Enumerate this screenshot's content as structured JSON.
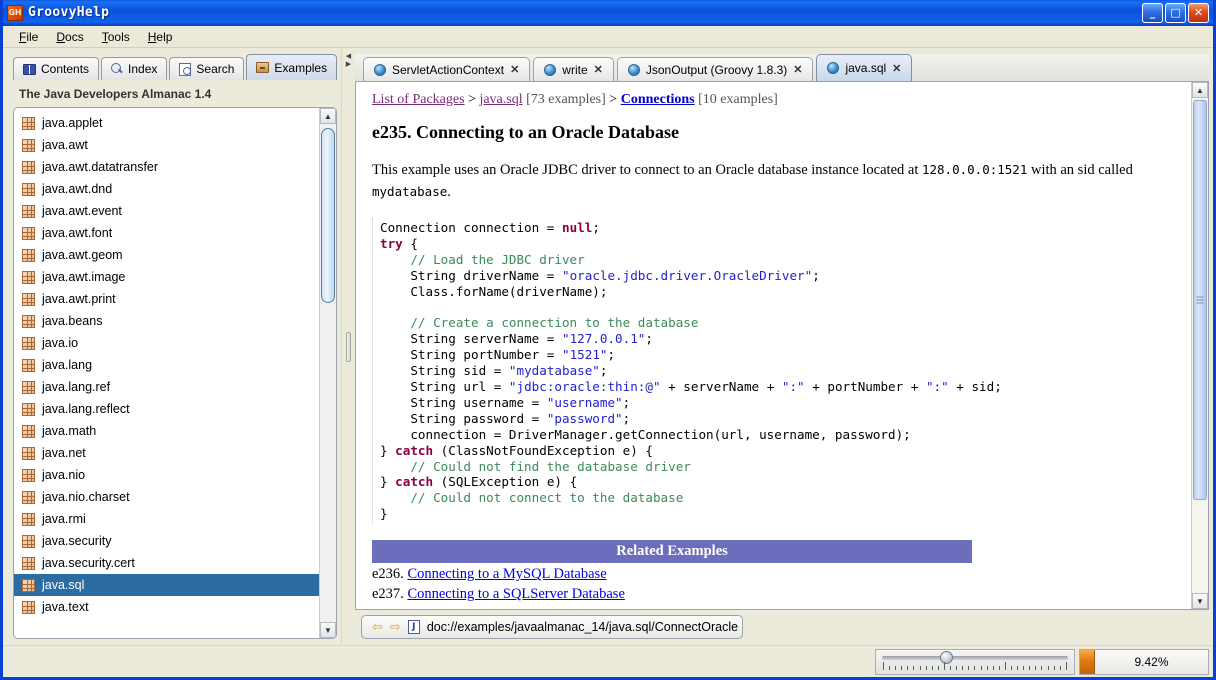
{
  "window": {
    "title": "GroovyHelp",
    "icon": "app-icon",
    "buttons": {
      "minimize": "_",
      "maximize": "□",
      "close": "✕"
    }
  },
  "menubar": {
    "items": [
      {
        "label": "File",
        "mnemonic": "F"
      },
      {
        "label": "Docs",
        "mnemonic": "D"
      },
      {
        "label": "Tools",
        "mnemonic": "T"
      },
      {
        "label": "Help",
        "mnemonic": "H"
      }
    ]
  },
  "sidebar": {
    "tabs": [
      {
        "label": "Contents",
        "icon": "book-icon",
        "active": false
      },
      {
        "label": "Index",
        "icon": "magnifier-icon",
        "active": false
      },
      {
        "label": "Search",
        "icon": "document-search-icon",
        "active": false
      },
      {
        "label": "Examples",
        "icon": "drawer-icon",
        "active": true
      }
    ],
    "heading": "The Java Developers Almanac 1.4",
    "tree_items": [
      {
        "label": "java.applet",
        "selected": false
      },
      {
        "label": "java.awt",
        "selected": false
      },
      {
        "label": "java.awt.datatransfer",
        "selected": false
      },
      {
        "label": "java.awt.dnd",
        "selected": false
      },
      {
        "label": "java.awt.event",
        "selected": false
      },
      {
        "label": "java.awt.font",
        "selected": false
      },
      {
        "label": "java.awt.geom",
        "selected": false
      },
      {
        "label": "java.awt.image",
        "selected": false
      },
      {
        "label": "java.awt.print",
        "selected": false
      },
      {
        "label": "java.beans",
        "selected": false
      },
      {
        "label": "java.io",
        "selected": false
      },
      {
        "label": "java.lang",
        "selected": false
      },
      {
        "label": "java.lang.ref",
        "selected": false
      },
      {
        "label": "java.lang.reflect",
        "selected": false
      },
      {
        "label": "java.math",
        "selected": false
      },
      {
        "label": "java.net",
        "selected": false
      },
      {
        "label": "java.nio",
        "selected": false
      },
      {
        "label": "java.nio.charset",
        "selected": false
      },
      {
        "label": "java.rmi",
        "selected": false
      },
      {
        "label": "java.security",
        "selected": false
      },
      {
        "label": "java.security.cert",
        "selected": false
      },
      {
        "label": "java.sql",
        "selected": true
      },
      {
        "label": "java.text",
        "selected": false
      }
    ]
  },
  "editor": {
    "tabs": [
      {
        "label": "ServletActionContext",
        "icon": "globe-icon",
        "close": "✕",
        "active": false
      },
      {
        "label": "write",
        "icon": "globe-icon",
        "close": "✕",
        "active": false
      },
      {
        "label": "JsonOutput (Groovy 1.8.3)",
        "icon": "globe-icon",
        "close": "✕",
        "active": false
      },
      {
        "label": "java.sql",
        "icon": "globe-icon",
        "close": "✕",
        "active": true
      }
    ]
  },
  "document": {
    "breadcrumb": {
      "packages_link": "List of Packages",
      "sep1": " > ",
      "package_link": "java.sql",
      "package_count": "[73 examples]",
      "sep2": " > ",
      "section_link": "Connections",
      "section_count": "[10 examples]"
    },
    "title": "e235. Connecting to an Oracle Database",
    "paragraph": {
      "part1": "This example uses an Oracle JDBC driver to connect to an Oracle database instance located at ",
      "host": "128.0.0.0:1521",
      "part2": " with an sid called ",
      "sid": "mydatabase",
      "part3": "."
    },
    "code_lines": [
      [
        {
          "t": "Connection connection = ",
          "c": ""
        },
        {
          "t": "null",
          "c": "kw"
        },
        {
          "t": ";",
          "c": ""
        }
      ],
      [
        {
          "t": "try",
          "c": "kw"
        },
        {
          "t": " {",
          "c": ""
        }
      ],
      [
        {
          "t": "    // Load the JDBC driver",
          "c": "cm"
        }
      ],
      [
        {
          "t": "    String driverName = ",
          "c": ""
        },
        {
          "t": "\"oracle.jdbc.driver.OracleDriver\"",
          "c": "st"
        },
        {
          "t": ";",
          "c": ""
        }
      ],
      [
        {
          "t": "    Class.forName(driverName);",
          "c": ""
        }
      ],
      [
        {
          "t": "",
          "c": ""
        }
      ],
      [
        {
          "t": "    // Create a connection to the database",
          "c": "cm"
        }
      ],
      [
        {
          "t": "    String serverName = ",
          "c": ""
        },
        {
          "t": "\"127.0.0.1\"",
          "c": "st"
        },
        {
          "t": ";",
          "c": ""
        }
      ],
      [
        {
          "t": "    String portNumber = ",
          "c": ""
        },
        {
          "t": "\"1521\"",
          "c": "st"
        },
        {
          "t": ";",
          "c": ""
        }
      ],
      [
        {
          "t": "    String sid = ",
          "c": ""
        },
        {
          "t": "\"mydatabase\"",
          "c": "st"
        },
        {
          "t": ";",
          "c": ""
        }
      ],
      [
        {
          "t": "    String url = ",
          "c": ""
        },
        {
          "t": "\"jdbc:oracle:thin:@\"",
          "c": "st"
        },
        {
          "t": " + serverName + ",
          "c": ""
        },
        {
          "t": "\":\"",
          "c": "st"
        },
        {
          "t": " + portNumber + ",
          "c": ""
        },
        {
          "t": "\":\"",
          "c": "st"
        },
        {
          "t": " + sid;",
          "c": ""
        }
      ],
      [
        {
          "t": "    String username = ",
          "c": ""
        },
        {
          "t": "\"username\"",
          "c": "st"
        },
        {
          "t": ";",
          "c": ""
        }
      ],
      [
        {
          "t": "    String password = ",
          "c": ""
        },
        {
          "t": "\"password\"",
          "c": "st"
        },
        {
          "t": ";",
          "c": ""
        }
      ],
      [
        {
          "t": "    connection = DriverManager.getConnection(url, username, password);",
          "c": ""
        }
      ],
      [
        {
          "t": "} ",
          "c": ""
        },
        {
          "t": "catch",
          "c": "kw"
        },
        {
          "t": " (ClassNotFoundException e) {",
          "c": ""
        }
      ],
      [
        {
          "t": "    // Could not find the database driver",
          "c": "cm"
        }
      ],
      [
        {
          "t": "} ",
          "c": ""
        },
        {
          "t": "catch",
          "c": "kw"
        },
        {
          "t": " (SQLException e) {",
          "c": ""
        }
      ],
      [
        {
          "t": "    // Could not connect to the database",
          "c": "cm"
        }
      ],
      [
        {
          "t": "}",
          "c": ""
        }
      ]
    ],
    "related": {
      "header": "Related Examples",
      "items": [
        {
          "id": "e236.",
          "label": "Connecting to a MySQL Database"
        },
        {
          "id": "e237.",
          "label": "Connecting to a SQLServer Database"
        }
      ]
    }
  },
  "addressbar": {
    "back": "⇦",
    "forward": "⇨",
    "doc_icon": "J",
    "url": "doc://examples/javaalmanac_14/java.sql/ConnectOracle"
  },
  "statusbar": {
    "memory_percent": "9.42%"
  },
  "colors": {
    "titlebar_blue": "#0a4fdc",
    "selection_blue": "#2b6ca3",
    "related_header": "#6d6dbe",
    "link_purple": "#7a2a7a",
    "link_blue": "#0000cc",
    "keyword": "#8b0040",
    "comment": "#3c8a5c",
    "string": "#2222cc",
    "accent_orange": "#e07a10"
  }
}
